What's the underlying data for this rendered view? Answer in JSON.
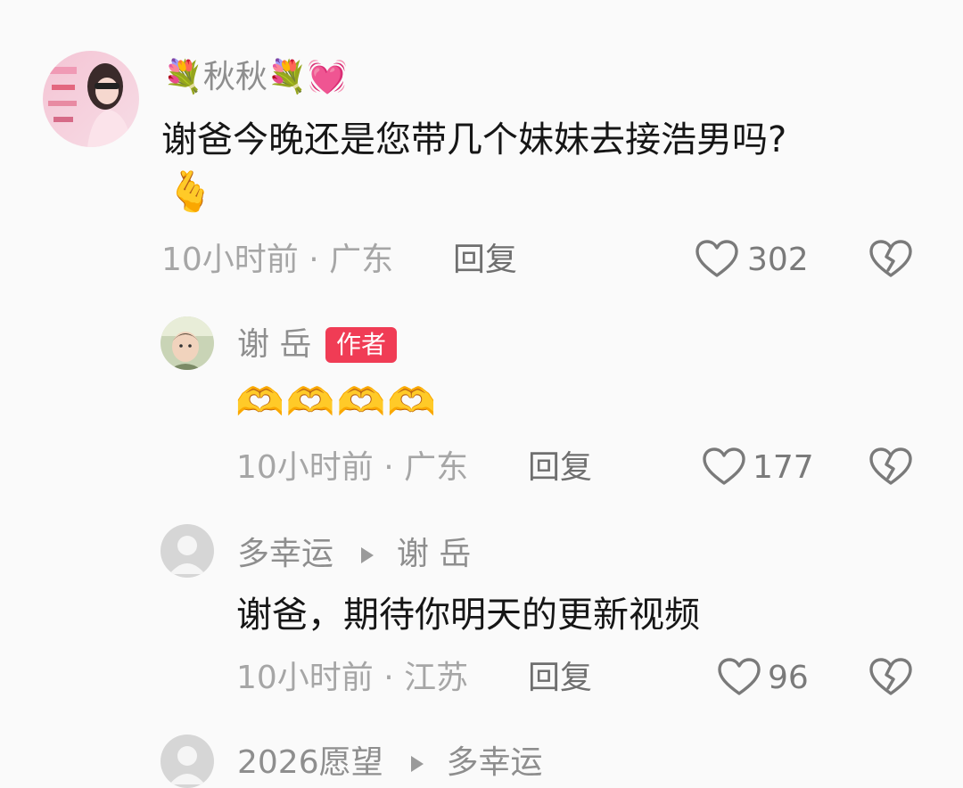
{
  "comments": [
    {
      "user": "秋秋",
      "name_prefix_emoji": "💐",
      "name_suffix_emoji": "💐💓",
      "text": "谢爸今晚还是您带几个妹妹去接浩男吗?",
      "text_emoji": "🫰",
      "time": "10小时前",
      "location": "广东",
      "reply_label": "回复",
      "likes": "302",
      "avatar_icon": "portrait-avatar-pink"
    },
    {
      "user": "谢 岳",
      "badge": "作者",
      "emojis": "🫶🫶🫶🫶",
      "time": "10小时前",
      "location": "广东",
      "reply_label": "回复",
      "likes": "177",
      "avatar_icon": "baby-photo-avatar"
    },
    {
      "user": "多幸运",
      "reply_to": "谢 岳",
      "text": "谢爸，期待你明天的更新视频",
      "time": "10小时前",
      "location": "江苏",
      "reply_label": "回复",
      "likes": "96",
      "avatar_icon": "default-user-avatar"
    },
    {
      "user": "2026愿望",
      "reply_to": "多幸运",
      "avatar_icon": "default-user-avatar"
    }
  ],
  "separator": "·",
  "icons": {
    "like": "heart-outline-icon",
    "dislike": "broken-heart-icon",
    "reply_arrow": "play-triangle-icon"
  },
  "colors": {
    "badge": "#f03c55",
    "name": "#8e8e8e",
    "content": "#161616",
    "meta": "#a6a6a6"
  }
}
